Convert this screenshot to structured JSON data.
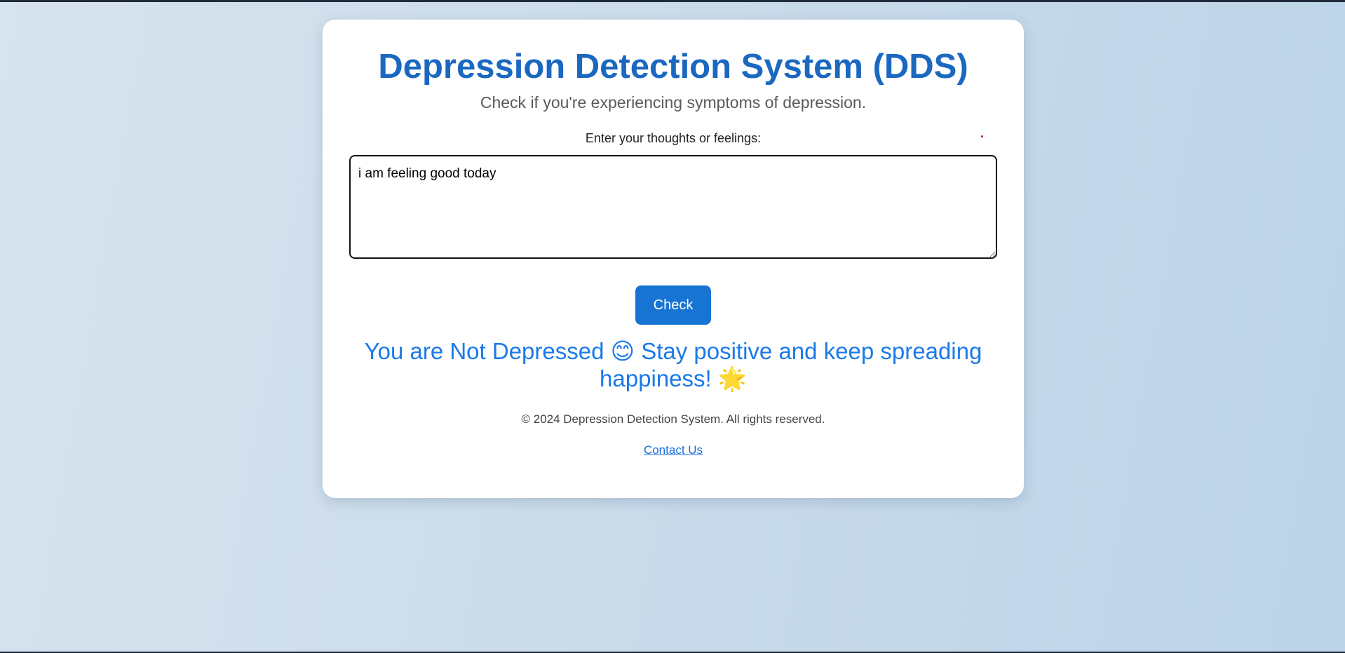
{
  "page": {
    "title": "Depression Detection System (DDS)",
    "subtitle": "Check if you're experiencing symptoms of depression."
  },
  "form": {
    "label": "Enter your thoughts or feelings:",
    "thoughts_value": "i am feeling good today",
    "submit_label": "Check"
  },
  "result": {
    "message": "You are Not Depressed 😊 Stay positive and keep spreading happiness! 🌟"
  },
  "footer": {
    "copyright": "© 2024 Depression Detection System. All rights reserved.",
    "contact_label": "Contact Us"
  },
  "colors": {
    "title": "#1a68c0",
    "button": "#1874d2",
    "result": "#1a7ae8",
    "link": "#1a6fdc"
  }
}
